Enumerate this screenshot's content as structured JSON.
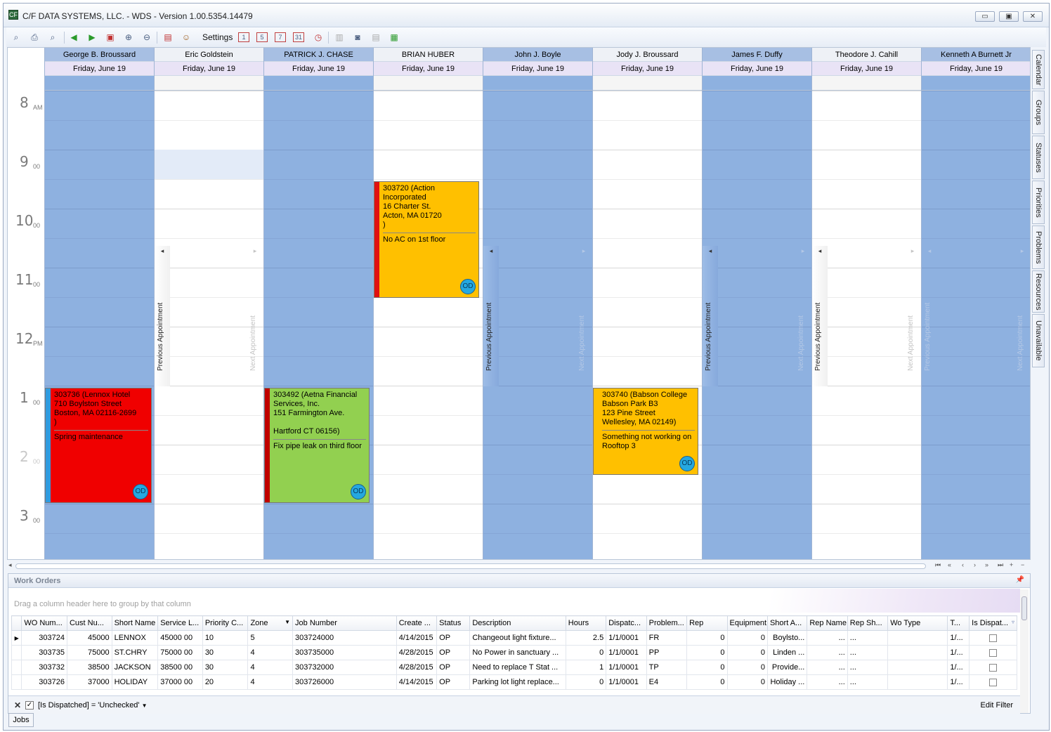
{
  "window": {
    "title": "C/F DATA SYSTEMS, LLC. - WDS - Version 1.00.5354.14479",
    "app_icon": "CF",
    "min": "▭",
    "max": "▣",
    "close": "✕"
  },
  "toolbar": {
    "settings_label": "Settings",
    "day1": "1",
    "day5": "5",
    "day7": "7",
    "day31": "31"
  },
  "hours": [
    {
      "h": "8",
      "m": "AM"
    },
    {
      "h": "9",
      "m": "00"
    },
    {
      "h": "10",
      "m": "00"
    },
    {
      "h": "11",
      "m": "00"
    },
    {
      "h": "12",
      "m": "PM"
    },
    {
      "h": "1",
      "m": "00"
    },
    {
      "h": "2",
      "m": "00"
    },
    {
      "h": "3",
      "m": "00"
    }
  ],
  "nav": {
    "prev": "Previous Appointment",
    "next": "Next Appointment",
    "left_arrow": "◂",
    "right_arrow": "▸"
  },
  "resources": [
    {
      "name": "George B. Broussard",
      "date": "Friday, June 19"
    },
    {
      "name": "Eric Goldstein",
      "date": "Friday, June 19"
    },
    {
      "name": "PATRICK J. CHASE",
      "date": "Friday, June 19"
    },
    {
      "name": "BRIAN HUBER",
      "date": "Friday, June 19"
    },
    {
      "name": "John J. Boyle",
      "date": "Friday, June 19"
    },
    {
      "name": "Jody J. Broussard",
      "date": "Friday, June 19"
    },
    {
      "name": "James F. Duffy",
      "date": "Friday, June 19"
    },
    {
      "name": "Theodore J. Cahill",
      "date": "Friday, June 19"
    },
    {
      "name": "Kenneth A Burnett Jr",
      "date": "Friday, June 19"
    }
  ],
  "appointments": [
    {
      "lines": [
        "303736 (Lennox Hotel",
        "710 Boylston Street",
        "Boston, MA 02116-2699",
        ")"
      ],
      "desc": "Spring maintenance",
      "badge": "OD",
      "color": "#f00000",
      "bar": "#2f9be0"
    },
    {
      "lines": [
        "303720 (Action",
        "Incorporated",
        "16 Charter St.",
        "Acton, MA 01720",
        ")"
      ],
      "desc": "No AC on 1st floor",
      "badge": "OD",
      "color": "#ffc000",
      "bar": "#e01010"
    },
    {
      "lines": [
        "303492 (Aetna Financial",
        "Services, Inc.",
        "151 Farmington Ave.",
        "",
        "Hartford CT 06156)"
      ],
      "desc": "Fix pipe leak on third floor",
      "badge": "OD",
      "color": "#92d050",
      "bar": "#c00000"
    },
    {
      "lines": [
        "303740 (Babson College",
        "Babson Park B3",
        "123 Pine Street",
        "Wellesley, MA 02149)"
      ],
      "desc": "Something not working on Rooftop 3",
      "badge": "OD",
      "color": "#ffc000",
      "bar": "#ffc000"
    }
  ],
  "side_tabs": [
    "Calendar",
    "Groups",
    "Statuses",
    "Priorities",
    "Problems",
    "Resources",
    "Unavailable"
  ],
  "scroll_nav": [
    "⏮",
    "«",
    "‹",
    "›",
    "»",
    "⏭",
    "+",
    "−"
  ],
  "work_orders": {
    "title": "Work Orders",
    "group_hint": "Drag a column header here to group by that column",
    "columns": [
      "WO Num...",
      "Cust Nu...",
      "Short Name",
      "Service L...",
      "Priority C...",
      "Zone",
      "Job Number",
      "Create ...",
      "Status",
      "Description",
      "Hours",
      "Dispatc...",
      "Problem...",
      "Rep",
      "Equipment",
      "Short A...",
      "Rep Name",
      "Rep Sh...",
      "Wo Type",
      "T...",
      "Is Dispat..."
    ],
    "rows": [
      [
        "303724",
        "45000",
        "LENNOX",
        "45000 00",
        "10",
        "5",
        "303724000",
        "4/14/2015",
        "OP",
        "Changeout light fixture...",
        "2.5",
        "1/1/0001",
        "FR",
        "0",
        "0",
        "Boylsto...",
        "...",
        "...",
        "",
        "1/..."
      ],
      [
        "303735",
        "75000",
        "ST.CHRY",
        "75000 00",
        "30",
        "4",
        "303735000",
        "4/28/2015",
        "OP",
        "No Power in sanctuary ...",
        "0",
        "1/1/0001",
        "PP",
        "0",
        "0",
        "Linden ...",
        "...",
        "...",
        "",
        "1/..."
      ],
      [
        "303732",
        "38500",
        "JACKSON",
        "38500 00",
        "30",
        "4",
        "303732000",
        "4/28/2015",
        "OP",
        "Need to replace T Stat ...",
        "1",
        "1/1/0001",
        "TP",
        "0",
        "0",
        "Provide...",
        "...",
        "...",
        "",
        "1/..."
      ],
      [
        "303726",
        "37000",
        "HOLIDAY",
        "37000 00",
        "20",
        "4",
        "303726000",
        "4/14/2015",
        "OP",
        "Parking lot light replace...",
        "0",
        "1/1/0001",
        "E4",
        "0",
        "0",
        "Holiday ...",
        "...",
        "...",
        "",
        "1/..."
      ]
    ],
    "filter_text": "[Is Dispatched] = 'Unchecked'",
    "edit_filter": "Edit Filter"
  },
  "bottom_tab": "Jobs"
}
